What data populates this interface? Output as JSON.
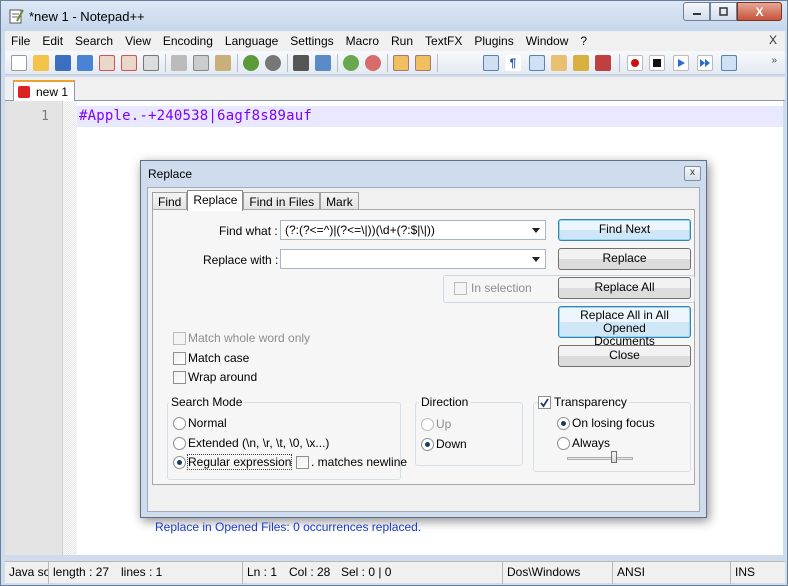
{
  "window": {
    "title": "*new  1 - Notepad++",
    "close_glyph": "X"
  },
  "menu": [
    "File",
    "Edit",
    "Search",
    "View",
    "Encoding",
    "Language",
    "Settings",
    "Macro",
    "Run",
    "TextFX",
    "Plugins",
    "Window",
    "?"
  ],
  "menu_close": "X",
  "toolbar_more": "»",
  "tab": {
    "label": "new  1"
  },
  "editor": {
    "line_number": "1",
    "line_text": "#Apple.-+240538|6agf8s89auf"
  },
  "dialog": {
    "title": "Replace",
    "close": "x",
    "tabs": [
      "Find",
      "Replace",
      "Find in Files",
      "Mark"
    ],
    "find_what_label": "Find what :",
    "find_what_value": "(?:(?<=^)|(?<=\\|))(\\d+(?:$|\\|))",
    "replace_with_label": "Replace with :",
    "replace_with_value": "",
    "in_selection": "In selection",
    "buttons": {
      "find_next": "Find Next",
      "replace": "Replace",
      "replace_all": "Replace All",
      "replace_all_opened_1": "Replace All in All Opened",
      "replace_all_opened_2": "Documents",
      "close": "Close"
    },
    "options": {
      "match_whole_word": "Match whole word only",
      "match_case": "Match case",
      "wrap_around": "Wrap around"
    },
    "search_mode": {
      "title": "Search Mode",
      "normal": "Normal",
      "extended": "Extended (\\n, \\r, \\t, \\0, \\x...)",
      "regex": "Regular expression",
      "matches_newline": ". matches newline"
    },
    "direction": {
      "title": "Direction",
      "up": "Up",
      "down": "Down"
    },
    "transparency": {
      "title": "Transparency",
      "on_losing_focus": "On losing focus",
      "always": "Always"
    },
    "status": "Replace in Opened Files: 0 occurrences replaced."
  },
  "statusbar": {
    "lang": "Java so",
    "length": "length : 27",
    "lines": "lines : 1",
    "ln": "Ln : 1",
    "col": "Col : 28",
    "sel": "Sel : 0 | 0",
    "eol": "Dos\\Windows",
    "encoding": "ANSI",
    "mode": "INS"
  }
}
